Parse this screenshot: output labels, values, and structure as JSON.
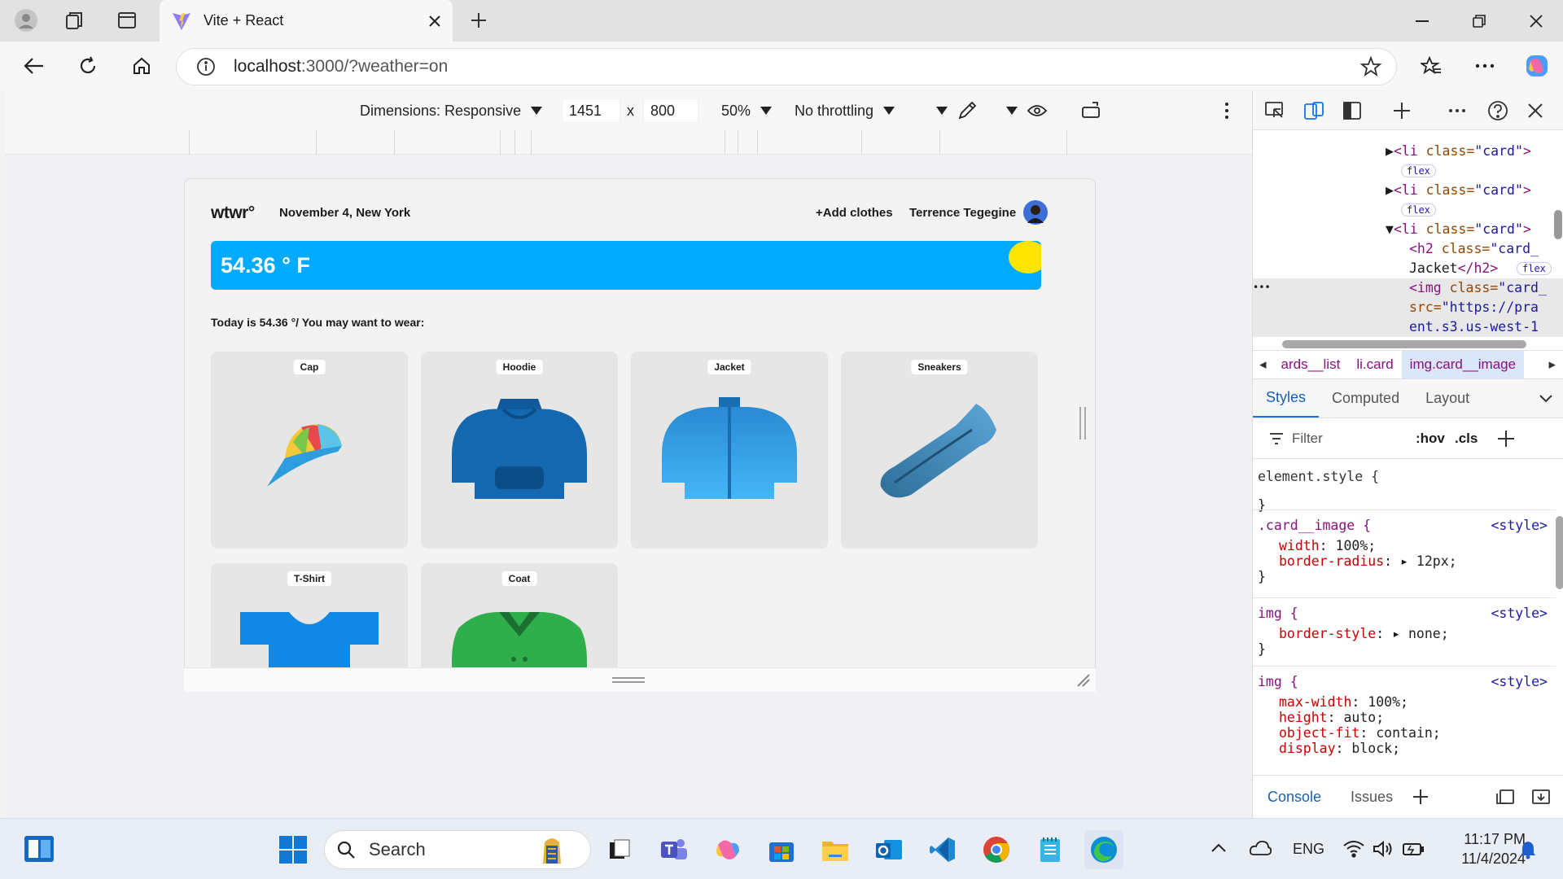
{
  "browser": {
    "tab_title": "Vite + React",
    "url_host": "localhost",
    "url_path": ":3000/?weather=on"
  },
  "device_toolbar": {
    "dimensions_label": "Dimensions: Responsive",
    "width": "1451",
    "height": "800",
    "x_sep": "x",
    "zoom": "50%",
    "throttling": "No throttling"
  },
  "app": {
    "logo": "wtwr°",
    "date_location": "November 4, New York",
    "add_clothes": "+Add clothes",
    "username": "Terrence Tegegine",
    "temperature": "54.36 ° F",
    "wear_text": "Today is 54.36 °/ You may want to wear:",
    "cards": [
      {
        "label": "Cap",
        "icon": "cap-icon"
      },
      {
        "label": "Hoodie",
        "icon": "hoodie-icon"
      },
      {
        "label": "Jacket",
        "icon": "jacket-icon"
      },
      {
        "label": "Sneakers",
        "icon": "sneakers-icon"
      },
      {
        "label": "T-Shirt",
        "icon": "tshirt-icon"
      },
      {
        "label": "Coat",
        "icon": "coat-icon"
      }
    ]
  },
  "devtools": {
    "elements_lines": [
      {
        "tag_open": "<li",
        "attr": " class=",
        "val": "\"card\"",
        "tag_close": ">"
      },
      {
        "tag_open": "<li",
        "attr": " class=",
        "val": "\"card\"",
        "tag_close": ">"
      },
      {
        "tag_open": "<li",
        "attr": " class=",
        "val": "\"card\"",
        "tag_close": ">"
      },
      {
        "tag_open": "<h2",
        "attr": " class=",
        "val": "\"card_",
        "tag_close": ""
      },
      {
        "text": "Jacket",
        "tag_close": "</h2>"
      },
      {
        "tag_open": "<img",
        "attr": " class=",
        "val": "\"card_",
        "tag_close": ""
      },
      {
        "attr": "src=",
        "val": "\"https://pra"
      },
      {
        "val": "ent.s3.us-west-1"
      }
    ],
    "flex_badge": "flex",
    "ellipsis": "•••",
    "breadcrumbs": [
      "ards__list",
      "li.card",
      "img.card__image"
    ],
    "style_tabs": [
      "Styles",
      "Computed",
      "Layout"
    ],
    "filter_placeholder": "Filter",
    "hov": ":hov",
    "cls": ".cls",
    "rules": [
      {
        "selector": "element.style {",
        "close": "}"
      },
      {
        "selector": ".card__image {",
        "source": "<style>",
        "props": [
          {
            "name": "width",
            "value": "100%;"
          },
          {
            "name": "border-radius",
            "value": "12px;"
          }
        ],
        "close": "}"
      },
      {
        "selector": "img {",
        "source": "<style>",
        "props": [
          {
            "name": "border-style",
            "value": "none;"
          }
        ],
        "close": "}"
      },
      {
        "selector": "img {",
        "source": "<style>",
        "props": [
          {
            "name": "max-width",
            "value": "100%;"
          },
          {
            "name": "height",
            "value": "auto;"
          },
          {
            "name": "object-fit",
            "value": "contain;"
          },
          {
            "name": "display",
            "value": "block;"
          }
        ],
        "close": "}"
      }
    ],
    "drawer_tabs": [
      "Console",
      "Issues"
    ]
  },
  "taskbar": {
    "search_placeholder": "Search",
    "lang": "ENG",
    "time": "11:17 PM",
    "date": "11/4/2024"
  },
  "colors": {
    "weather_blue": "#00aaff",
    "sun_yellow": "#ffe400",
    "accent": "#1a73e8"
  }
}
